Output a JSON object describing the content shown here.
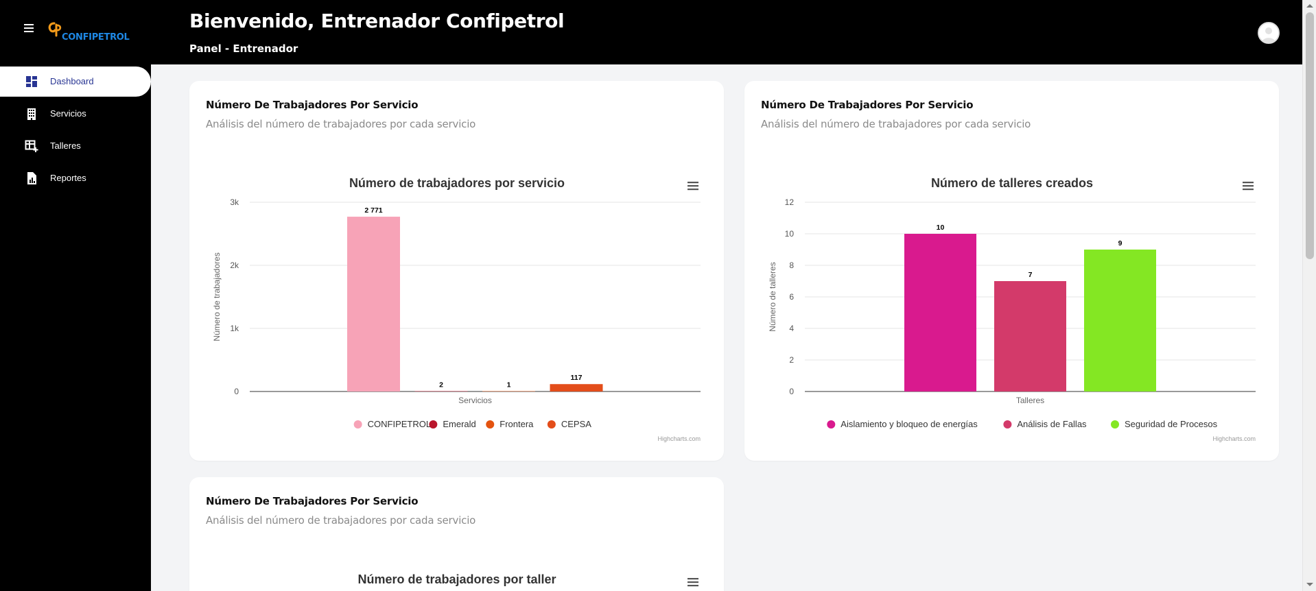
{
  "app": {
    "logo_text": "CONFIPETROL"
  },
  "header": {
    "title": "Bienvenido, Entrenador Confipetrol",
    "subtitle": "Panel - Entrenador"
  },
  "sidebar": {
    "items": [
      {
        "label": "Dashboard",
        "icon": "dashboard-icon",
        "active": true
      },
      {
        "label": "Servicios",
        "icon": "building-icon",
        "active": false
      },
      {
        "label": "Talleres",
        "icon": "table-add-icon",
        "active": false
      },
      {
        "label": "Reportes",
        "icon": "report-icon",
        "active": false
      }
    ]
  },
  "cards": [
    {
      "title": "Número De Trabajadores Por Servicio",
      "subtitle": "Análisis del número de trabajadores por cada servicio"
    },
    {
      "title": "Número De Trabajadores Por Servicio",
      "subtitle": "Análisis del número de trabajadores por cada servicio"
    },
    {
      "title": "Número De Trabajadores Por Servicio",
      "subtitle": "Análisis del número de trabajadores por cada servicio"
    }
  ],
  "colors": {
    "sidebar_bg": "#000000",
    "active_text": "#283593",
    "page_bg": "#f3f4f6"
  },
  "chart_data": [
    {
      "type": "bar",
      "title": "Número de trabajadores por servicio",
      "xlabel": "Servicios",
      "ylabel": "Número de trabajadores",
      "ylim": [
        0,
        3000
      ],
      "yticks": [
        "0",
        "1k",
        "2k",
        "3k"
      ],
      "ytick_values": [
        0,
        1000,
        2000,
        3000
      ],
      "grid": true,
      "legend": "bottom",
      "credits": "Highcharts.com",
      "series": [
        {
          "name": "CONFIPETROL",
          "value": 2771,
          "label": "2 771",
          "color": "#f7a3b7"
        },
        {
          "name": "Emerald",
          "value": 2,
          "label": "2",
          "color": "#b9162c"
        },
        {
          "name": "Frontera",
          "value": 1,
          "label": "1",
          "color": "#e4530f"
        },
        {
          "name": "CEPSA",
          "value": 117,
          "label": "117",
          "color": "#e34d1a"
        }
      ]
    },
    {
      "type": "bar",
      "title": "Número de talleres creados",
      "xlabel": "Talleres",
      "ylabel": "Número de talleres",
      "ylim": [
        0,
        12
      ],
      "yticks": [
        "0",
        "2",
        "4",
        "6",
        "8",
        "10",
        "12"
      ],
      "ytick_values": [
        0,
        2,
        4,
        6,
        8,
        10,
        12
      ],
      "grid": true,
      "legend": "bottom",
      "credits": "Highcharts.com",
      "series": [
        {
          "name": "Aislamiento y bloqueo de energías",
          "value": 10,
          "label": "10",
          "color": "#d91a8e"
        },
        {
          "name": "Análisis de Fallas",
          "value": 7,
          "label": "7",
          "color": "#d33a6a"
        },
        {
          "name": "Seguridad de Procesos",
          "value": 9,
          "label": "9",
          "color": "#84e723"
        }
      ]
    },
    {
      "type": "bar",
      "title": "Número de trabajadores por taller"
    }
  ]
}
